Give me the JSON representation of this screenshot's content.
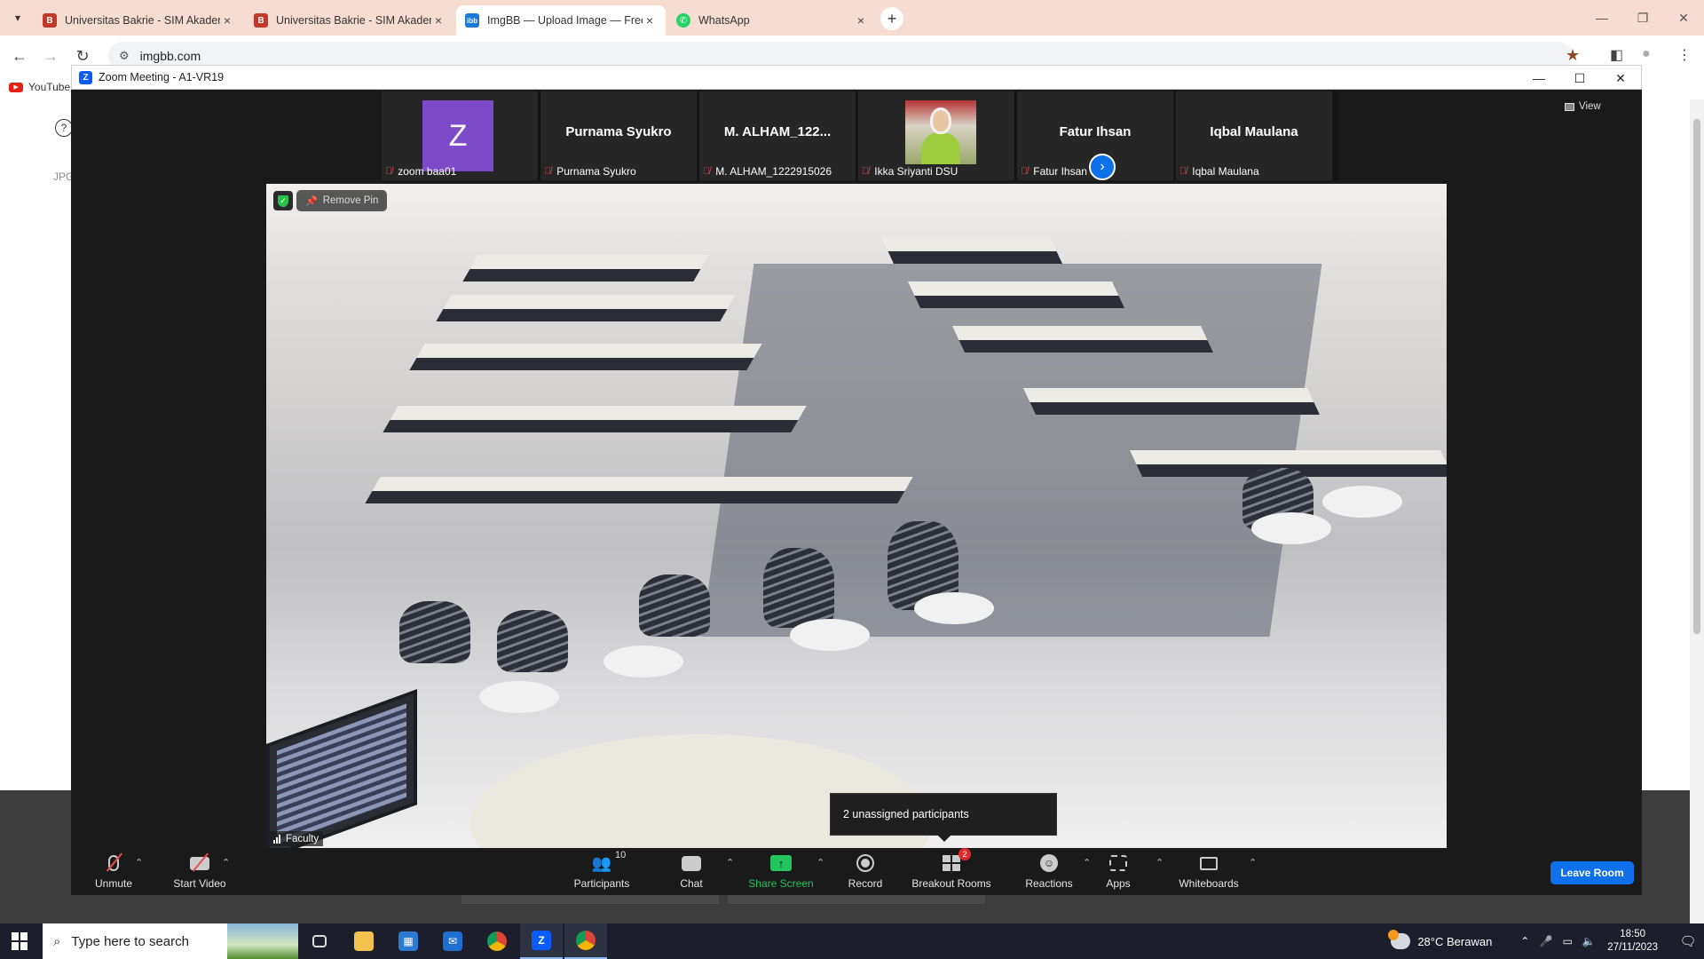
{
  "browser": {
    "tabs": [
      {
        "label": "Universitas Bakrie - SIM Akademik",
        "favicon": "bakrie-icon",
        "active": false
      },
      {
        "label": "Universitas Bakrie - SIM Akademik",
        "favicon": "bakrie-icon",
        "active": false
      },
      {
        "label": "ImgBB — Upload Image — Free",
        "favicon": "imgbb-icon",
        "active": true
      },
      {
        "label": "WhatsApp",
        "favicon": "whatsapp-icon",
        "active": false
      }
    ],
    "url": "imgbb.com",
    "bookmark": "YouTube",
    "page_fragment": "JPG"
  },
  "zoom": {
    "window_title": "Zoom Meeting - A1-VR19",
    "view_label": "View",
    "participants": [
      {
        "display": "Z",
        "label": "zoom baa01",
        "muted": true
      },
      {
        "display": "Purnama Syukro",
        "label": "Purnama Syukro",
        "muted": true
      },
      {
        "display": "M. ALHAM_122...",
        "label": "M. ALHAM_1222915026",
        "muted": true
      },
      {
        "display": "",
        "label": "Ikka Sriyanti DSU",
        "muted": true
      },
      {
        "display": "Fatur Ihsan",
        "label": "Fatur Ihsan",
        "muted": true
      },
      {
        "display": "Iqbal Maulana",
        "label": "Iqbal Maulana",
        "muted": true
      }
    ],
    "video": {
      "remove_pin": "Remove Pin",
      "speaker_label": "Faculty"
    },
    "tooltip": "2 unassigned participants",
    "controls": {
      "unmute": "Unmute",
      "start_video": "Start Video",
      "participants": "Participants",
      "participants_count": "10",
      "chat": "Chat",
      "share_screen": "Share Screen",
      "record": "Record",
      "breakout_rooms": "Breakout Rooms",
      "breakout_badge": "2",
      "reactions": "Reactions",
      "apps": "Apps",
      "whiteboards": "Whiteboards",
      "leave": "Leave Room"
    },
    "colors": {
      "accent": "#0e71eb",
      "share_green": "#22c55e",
      "muted_red": "#e54b4b",
      "badge_red": "#e02828"
    }
  },
  "taskbar": {
    "search_placeholder": "Type here to search",
    "weather": "28°C  Berawan",
    "time": "18:50",
    "date": "27/11/2023"
  }
}
